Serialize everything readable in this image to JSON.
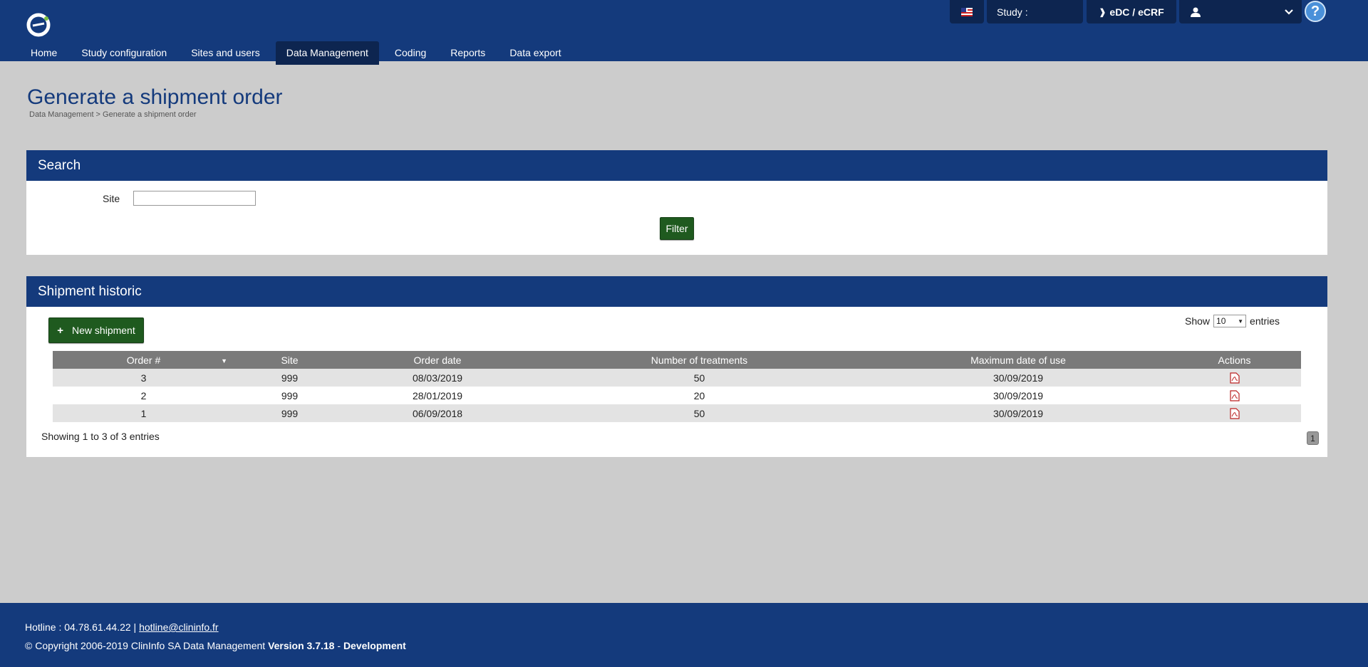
{
  "topbar": {
    "study_label": "Study :",
    "edc_label": "eDC / eCRF",
    "help_label": "?"
  },
  "nav": {
    "items": [
      "Home",
      "Study configuration",
      "Sites and users",
      "Data Management",
      "Coding",
      "Reports",
      "Data export"
    ],
    "active": "Data Management"
  },
  "page": {
    "title": "Generate a shipment order",
    "breadcrumb": "Data Management > Generate a shipment order"
  },
  "search": {
    "heading": "Search",
    "site_label": "Site",
    "site_value": "",
    "filter_label": "Filter"
  },
  "historic": {
    "heading": "Shipment historic",
    "new_button": "New shipment",
    "show_label": "Show",
    "entries_label": "entries",
    "page_size": "10",
    "columns": [
      "Order #",
      "Site",
      "Order date",
      "Number of treatments",
      "Maximum date of use",
      "Actions"
    ],
    "rows": [
      {
        "order": "3",
        "site": "999",
        "order_date": "08/03/2019",
        "treatments": "50",
        "max_date": "30/09/2019"
      },
      {
        "order": "2",
        "site": "999",
        "order_date": "28/01/2019",
        "treatments": "20",
        "max_date": "30/09/2019"
      },
      {
        "order": "1",
        "site": "999",
        "order_date": "06/09/2018",
        "treatments": "50",
        "max_date": "30/09/2019"
      }
    ],
    "showing": "Showing 1 to 3 of 3 entries",
    "page": "1"
  },
  "footer": {
    "hotline_prefix": "Hotline : 04.78.61.44.22 |",
    "hotline_email": "hotline@clininfo.fr",
    "copyright": "© Copyright 2006-2019 ClinInfo SA Data Management",
    "version": "Version 3.7.18",
    "separator": "-",
    "env": "Development"
  },
  "colors": {
    "brand": "#143a7c",
    "brand_dark": "#0d2550",
    "button_green": "#1f5a1f",
    "table_header": "#7a7a7a"
  }
}
